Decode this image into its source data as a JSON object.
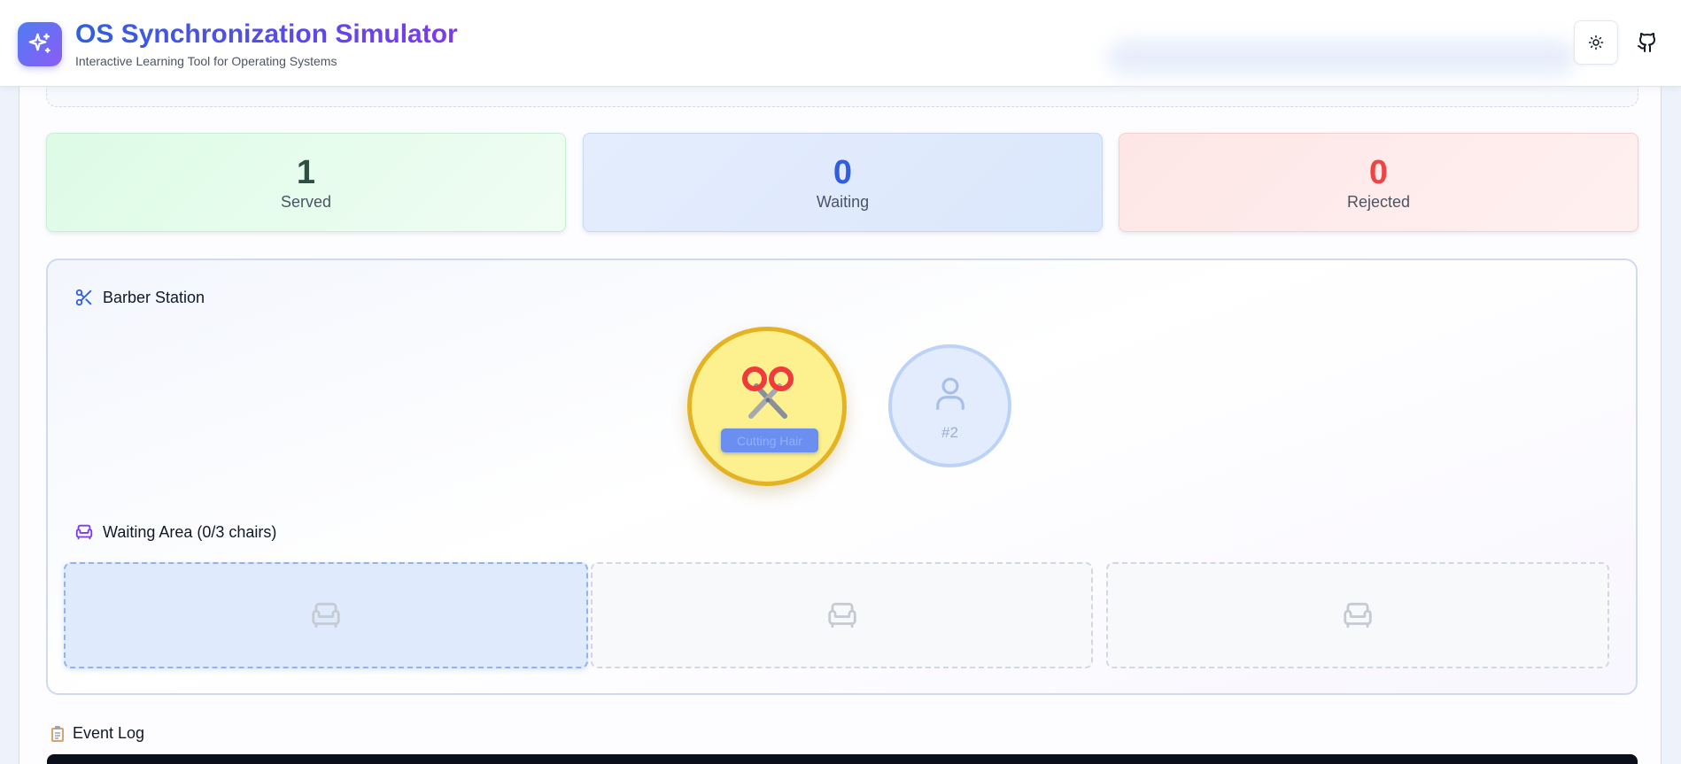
{
  "header": {
    "title": "OS Synchronization Simulator",
    "subtitle": "Interactive Learning Tool for Operating Systems",
    "logo_icon": "sparkles-icon",
    "theme_icon": "sun-icon",
    "github_icon": "github-icon"
  },
  "stats": {
    "served": {
      "value": "1",
      "label": "Served",
      "color": "#2f4f45"
    },
    "waiting": {
      "value": "0",
      "label": "Waiting",
      "color": "#2f5fe0"
    },
    "rejected": {
      "value": "0",
      "label": "Rejected",
      "color": "#ef4444"
    }
  },
  "barber_station": {
    "title": "Barber Station",
    "icon": "scissors-icon",
    "barber_emoji": "✂️",
    "barber_status": "Cutting Hair",
    "customer_id": "#2",
    "customer_icon": "user-icon"
  },
  "waiting_area": {
    "title": "Waiting Area (0/3 chairs)",
    "icon": "sofa-icon",
    "chairs": [
      {
        "state": "highlighted",
        "icon": "armchair-icon"
      },
      {
        "state": "empty",
        "icon": "armchair-icon"
      },
      {
        "state": "empty",
        "icon": "armchair-icon"
      }
    ]
  },
  "event_log": {
    "title": "Event Log",
    "icon": "clipboard-icon"
  },
  "colors": {
    "accent_blue": "#2f5fe0",
    "accent_purple": "#7c3aed",
    "barber_yellow": "#fdf08e",
    "barber_border": "#e4b324"
  }
}
